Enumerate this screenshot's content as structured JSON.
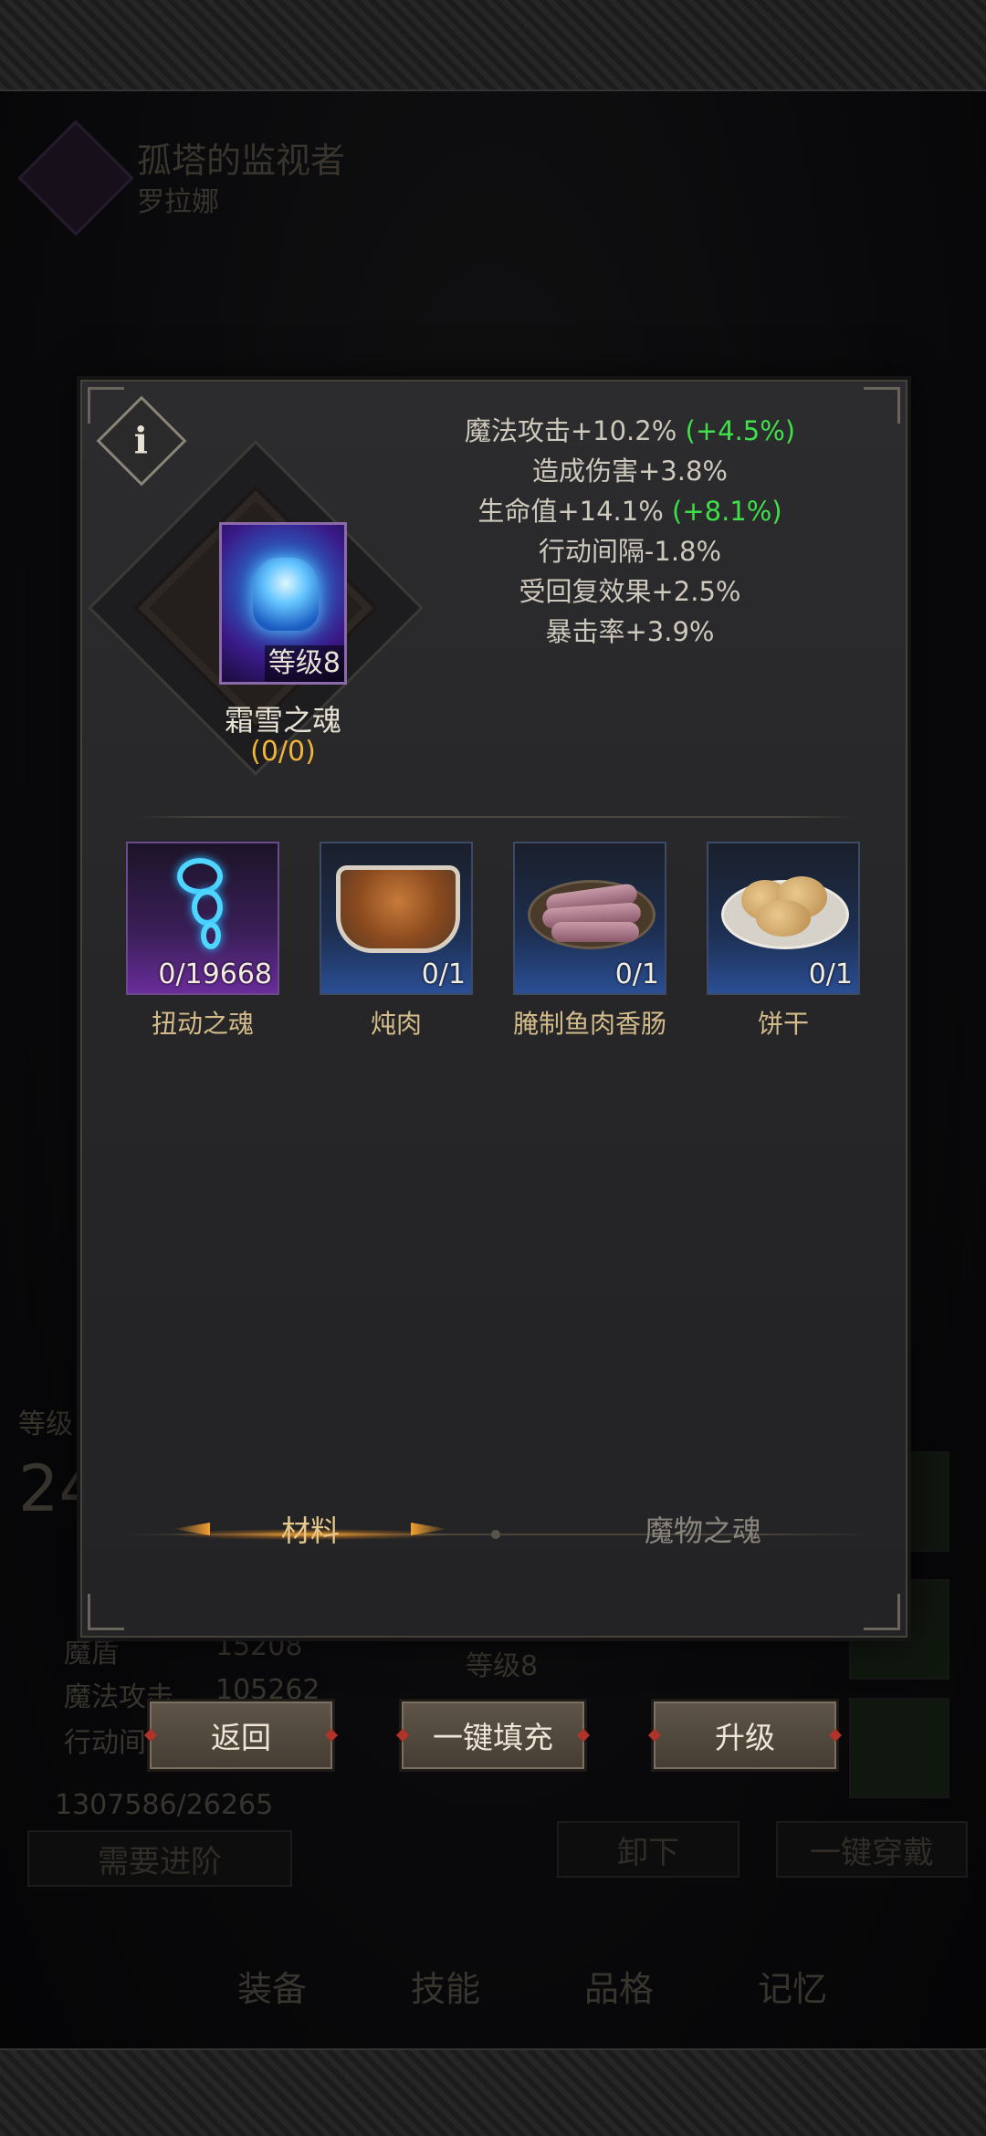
{
  "background": {
    "hero_title": "孤塔的监视者",
    "hero_subtitle": "罗拉娜",
    "level_label": "等级",
    "level_value": "24",
    "stat_magic_def_label": "魔盾",
    "stat_magic_def_value": "15208",
    "stat_magic_atk_label": "魔法攻击",
    "stat_magic_atk_value": "105262",
    "stat_action_label": "行动间",
    "resource": "1307586/26265",
    "need_advance": "需要进阶",
    "unequip": "卸下",
    "equip_all": "一键穿戴",
    "slot_level": "等级8",
    "nav_tabs": [
      "装备",
      "技能",
      "品格",
      "记忆"
    ]
  },
  "panel": {
    "soul": {
      "name": "霜雪之魂",
      "level": "等级8",
      "count": "(0/0)"
    },
    "stats": [
      {
        "text": "魔法攻击+10.2%",
        "bonus": "(+4.5%)"
      },
      {
        "text": "造成伤害+3.8%",
        "bonus": ""
      },
      {
        "text": "生命值+14.1%",
        "bonus": "(+8.1%)"
      },
      {
        "text": "行动间隔-1.8%",
        "bonus": ""
      },
      {
        "text": "受回复效果+2.5%",
        "bonus": ""
      },
      {
        "text": "暴击率+3.9%",
        "bonus": ""
      }
    ],
    "materials": [
      {
        "name": "扭动之魂",
        "qty": "0/19668"
      },
      {
        "name": "炖肉",
        "qty": "0/1"
      },
      {
        "name": "腌制鱼肉香肠",
        "qty": "0/1"
      },
      {
        "name": "饼干",
        "qty": "0/1"
      }
    ],
    "tabs": {
      "active": "材料",
      "inactive": "魔物之魂"
    }
  },
  "actions": {
    "back": "返回",
    "auto_fill": "一键填充",
    "upgrade": "升级"
  },
  "colors": {
    "bonus_green": "#3fe04a",
    "count_gold": "#f0b43a",
    "tab_active": "#e6c98a"
  }
}
